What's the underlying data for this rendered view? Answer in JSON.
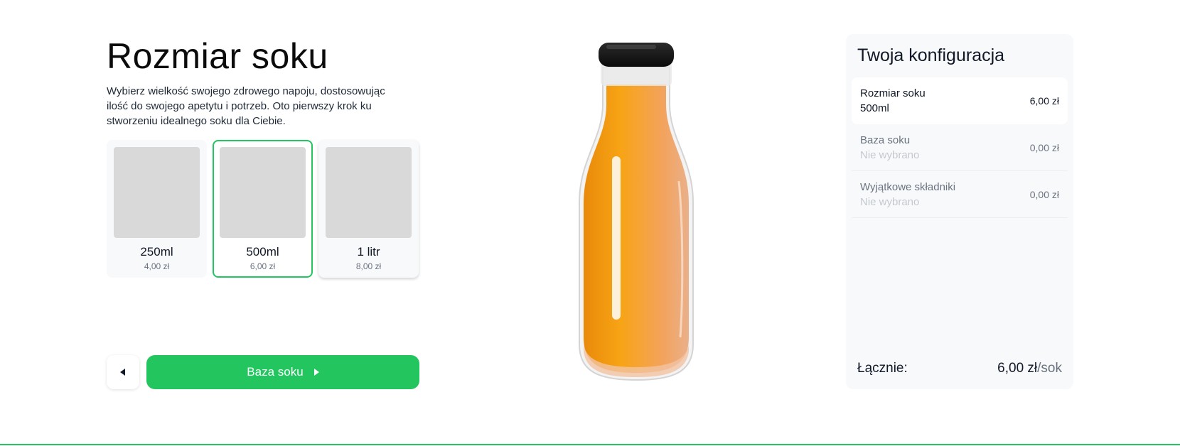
{
  "step": {
    "title": "Rozmiar soku",
    "description": "Wybierz wielkość swojego zdrowego napoju, dostosowując ilość do swojego apetytu i potrzeb. Oto pierwszy krok ku stworzeniu idealnego soku dla Ciebie."
  },
  "sizes": [
    {
      "name": "250ml",
      "price": "4,00 zł",
      "selected": false
    },
    {
      "name": "500ml",
      "price": "6,00 zł",
      "selected": true
    },
    {
      "name": "1 litr",
      "price": "8,00 zł",
      "selected": false
    }
  ],
  "navigation": {
    "back_icon": "caret-left-icon",
    "next_label": "Baza soku",
    "next_icon": "caret-right-icon"
  },
  "product_image": {
    "icon": "juice-bottle",
    "juice_color": "#f6a11a"
  },
  "summary": {
    "title": "Twoja konfiguracja",
    "rows": [
      {
        "label": "Rozmiar soku",
        "value": "500ml",
        "price": "6,00 zł",
        "active": true
      },
      {
        "label": "Baza soku",
        "value": "Nie wybrano",
        "price": "0,00 zł",
        "active": false
      },
      {
        "label": "Wyjątkowe składniki",
        "value": "Nie wybrano",
        "price": "0,00 zł",
        "active": false
      }
    ],
    "total_label": "Łącznie:",
    "total_amount": "6,00 zł",
    "total_unit": "/sok"
  },
  "colors": {
    "accent": "#22c55e",
    "panel_bg": "#f8f9fb",
    "placeholder": "#d9d9d9"
  }
}
